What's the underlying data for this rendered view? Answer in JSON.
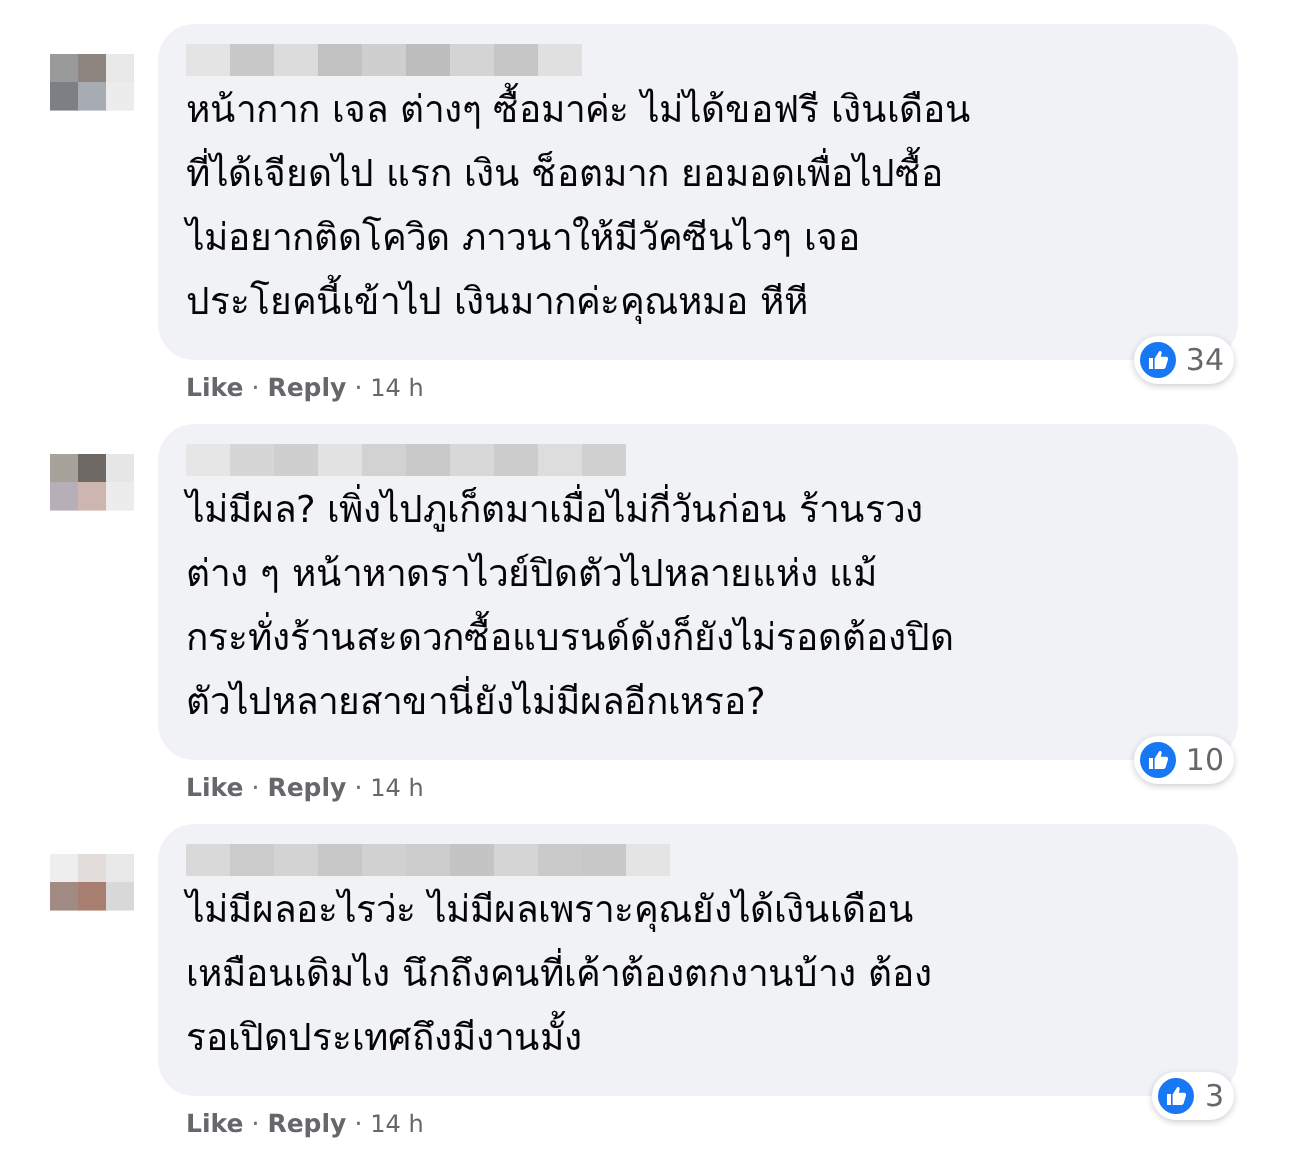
{
  "comments": [
    {
      "text_lines": [
        "หน้ากาก เจล ต่างๆ ซื้อมาค่ะ ไม่ได้ขอฟรี เงินเดือน",
        "ที่ได้เจียดไป แรก เงิน ช็อตมาก ยอมอดเพื่อไปซื้อ",
        "ไม่อยากติดโควิด ภาวนาให้มีวัคซีนไวๆ เจอ",
        "ประโยคนี้เข้าไป เงินมากค่ะคุณหมอ หีหี"
      ],
      "reactions": "34",
      "like": "Like",
      "separator": "·",
      "reply": "Reply",
      "time": "14 h"
    },
    {
      "text_lines": [
        "ไม่มีผล? เพิ่งไปภูเก็ตมาเมื่อไม่กี่วันก่อน ร้านรวง",
        "ต่าง ๆ หน้าหาดราไวย์ปิดตัวไปหลายแห่ง แม้",
        "กระทั่งร้านสะดวกซื้อแบรนด์ดังก็ยังไม่รอดต้องปิด",
        "ตัวไปหลายสาขานี่ยังไม่มีผลอีกเหรอ?"
      ],
      "reactions": "10",
      "like": "Like",
      "separator": "·",
      "reply": "Reply",
      "time": "14 h"
    },
    {
      "text_lines": [
        "ไม่มีผลอะไรว่ะ ไม่มีผลเพราะคุณยังได้เงินเดือน",
        "เหมือนเดิมไง นึกถึงคนที่เค้าต้องตกงานบ้าง ต้อง",
        "รอเปิดประเทศถึงมีงานมั้ง"
      ],
      "reactions": "3",
      "like": "Like",
      "separator": "·",
      "reply": "Reply",
      "time": "14 h"
    }
  ]
}
